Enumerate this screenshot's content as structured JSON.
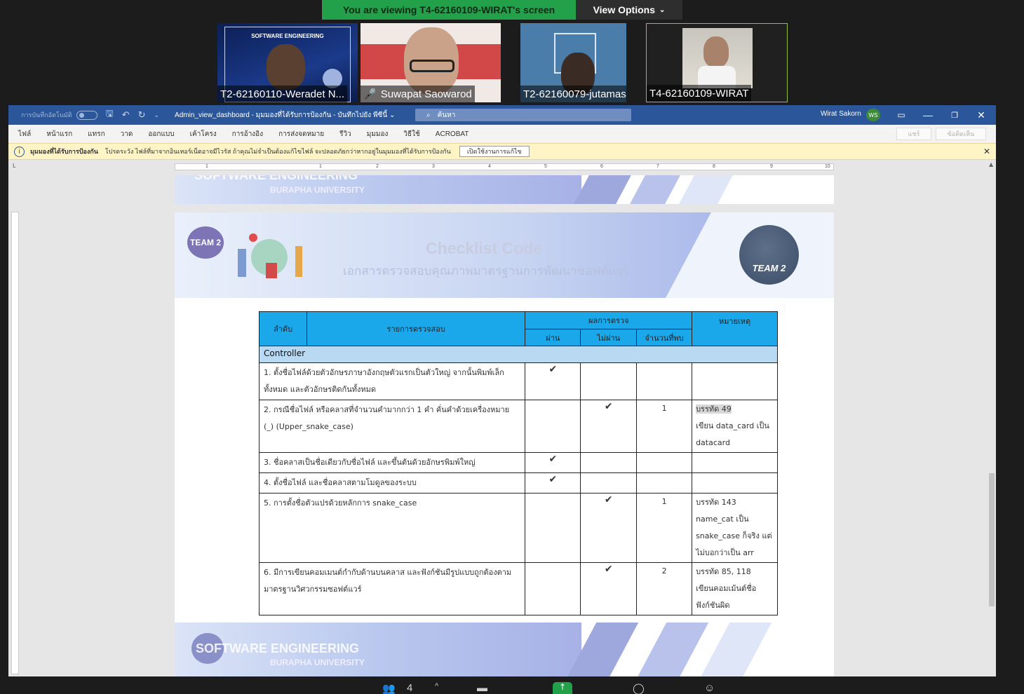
{
  "zoom": {
    "banner_text": "You are viewing T4-62160109-WIRAT's screen",
    "view_options_label": "View Options",
    "participants": [
      {
        "name": "T2-62160110-Weradet N..."
      },
      {
        "name": "Suwapat Saowarod",
        "muted": true
      },
      {
        "name": "T2-62160079-jutamas"
      },
      {
        "name": "T4-62160109-WIRAT"
      }
    ],
    "thumb1_caption": "SOFTWARE ENGINEERING",
    "participant_count": "4"
  },
  "word": {
    "autosave_label": "การบันทึกอัตโนมัติ",
    "doc_title": "Admin_view_dashboard  -  มุมมองที่ได้รับการป้องกัน  -  บันทึกไปยัง พีซีนี้ ⌄",
    "search_placeholder": "ค้นหา",
    "user_name": "Wirat Sakorn",
    "user_initials": "WS",
    "menu": [
      "ไฟล์",
      "หน้าแรก",
      "แทรก",
      "วาด",
      "ออกแบบ",
      "เค้าโครง",
      "การอ้างอิง",
      "การส่งจดหมาย",
      "รีวิว",
      "มุมมอง",
      "วิธีใช้",
      "ACROBAT"
    ],
    "share_label": "แชร์",
    "comments_label": "ข้อคิดเห็น",
    "protected_view_title": "มุมมองที่ได้รับการป้องกัน",
    "protected_view_message": "โปรดระวัง ไฟล์ที่มาจากอินเทอร์เน็ตอาจมีไวรัส ถ้าคุณไม่จำเป็นต้องแก้ไขไฟล์ จะปลอดภัยกว่าหากอยู่ในมุมมองที่ได้รับการป้องกัน",
    "enable_editing_label": "เปิดใช้งานการแก้ไข",
    "ruler_labels": [
      "1",
      "1",
      "2",
      "3",
      "4",
      "5",
      "6",
      "7",
      "8",
      "9",
      "10"
    ]
  },
  "doc": {
    "banner_top_line": "SOFTWARE ENGINEERING",
    "banner_sub": "BURAPHA UNIVERSITY",
    "team_badge": "TEAM 2",
    "header_title": "Checklist Code",
    "header_subtitle": "เอกสารตรวจสอบคุณภาพมาตรฐานการพัฒนาซอฟต์แวร์",
    "logo_text": "TEAM 2",
    "table": {
      "headers": {
        "no": "ลำดับ",
        "item": "รายการตรวจสอบ",
        "result": "ผลการตรวจ",
        "pass": "ผ่าน",
        "fail": "ไม่ผ่าน",
        "count": "จำนวนที่พบ",
        "note": "หมายเหตุ"
      },
      "section": "Controller",
      "rows": [
        {
          "item": "1. ตั้งชื่อไฟล์ด้วยตัวอักษรภาษาอังกฤษตัวแรกเป็นตัวใหญ่ จากนั้นพิมพ์เล็กทั้งหมด และตัวอักษรติดกันทั้งหมด",
          "pass": "✔",
          "fail": "",
          "count": "",
          "note_line1": "",
          "note_rest": ""
        },
        {
          "item": "2. กรณีชื่อไฟล์ หรือคลาสที่จำนวนคำมากกว่า 1 คำ คั่นคำด้วยเครื่องหมาย (_) (Upper_snake_case)",
          "pass": "",
          "fail": "✔",
          "count": "1",
          "note_line1": "บรรทัด 49",
          "note_rest": "เขียน data_card เป็น datacard"
        },
        {
          "item": "3. ชื่อคลาสเป็นชื่อเดียวกับชื่อไฟล์ และขึ้นต้นด้วยอักษรพิมพ์ใหญ่",
          "pass": "✔",
          "fail": "",
          "count": "",
          "note_line1": "",
          "note_rest": ""
        },
        {
          "item": "4. ตั้งชื่อไฟล์ และชื่อคลาสตามโมดูลของระบบ",
          "pass": "✔",
          "fail": "",
          "count": "",
          "note_line1": "",
          "note_rest": ""
        },
        {
          "item": "5. การตั้งชื่อตัวแปรด้วยหลักการ snake_case",
          "pass": "",
          "fail": "✔",
          "count": "1",
          "note_line1": "บรรทัด 143",
          "note_rest": "name_cat เป็น snake_case ก็จริง แต่ไม่บอกว่าเป็น arr"
        },
        {
          "item": "6. มีการเขียนคอมเมนต์กำกับด้านบนคลาส และฟังก์ชันมีรูปแบบถูกต้องตามมาตรฐานวิศวกรรมซอฟต์แวร์",
          "pass": "",
          "fail": "✔",
          "count": "2",
          "note_line1": "บรรทัด 85, 118",
          "note_rest": "เขียนคอมเม้นต์ชื่อฟังก์ชันผิด"
        }
      ]
    }
  },
  "colors": {
    "zoom_green": "#23a04a",
    "word_blue": "#2b579a",
    "table_header": "#1ba8ea",
    "section_row": "#b9d8f1"
  }
}
